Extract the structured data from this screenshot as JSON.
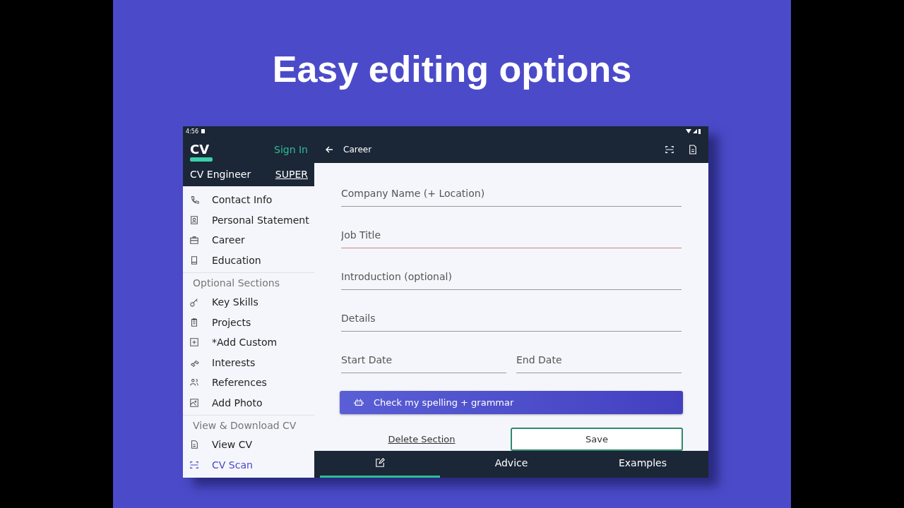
{
  "headline": "Easy editing options",
  "status_bar": {
    "time": "4:56"
  },
  "sidebar": {
    "logo": "CV",
    "sign_in": "Sign In",
    "app_name": "CV Engineer",
    "badge": "SUPER",
    "items": [
      {
        "kind": "item",
        "label": "Contact Info",
        "selected": false
      },
      {
        "kind": "item",
        "label": "Personal Statement",
        "selected": false
      },
      {
        "kind": "item",
        "label": "Career",
        "selected": false
      },
      {
        "kind": "item",
        "label": "Education",
        "selected": false
      },
      {
        "kind": "heading",
        "label": "Optional Sections"
      },
      {
        "kind": "item",
        "label": "Key Skills",
        "selected": false
      },
      {
        "kind": "item",
        "label": "Projects",
        "selected": false
      },
      {
        "kind": "item",
        "label": "*Add Custom",
        "selected": false
      },
      {
        "kind": "item",
        "label": "Interests",
        "selected": false
      },
      {
        "kind": "item",
        "label": "References",
        "selected": false
      },
      {
        "kind": "item",
        "label": "Add Photo",
        "selected": false
      },
      {
        "kind": "heading",
        "label": "View & Download CV"
      },
      {
        "kind": "item",
        "label": "View CV",
        "selected": false
      },
      {
        "kind": "item",
        "label": "CV Scan",
        "selected": true
      }
    ]
  },
  "header": {
    "title": "Career"
  },
  "form": {
    "rows": [
      [
        {
          "placeholder": "Company Name (+ Location)",
          "focused": false
        }
      ],
      [
        {
          "placeholder": "Job Title",
          "focused": true
        }
      ],
      [
        {
          "placeholder": "Introduction (optional)",
          "focused": false
        }
      ],
      [
        {
          "placeholder": "Details",
          "focused": false
        }
      ],
      [
        {
          "placeholder": "Start Date",
          "focused": false
        },
        {
          "placeholder": "End Date",
          "focused": false
        }
      ]
    ],
    "spell_button": "Check my spelling + grammar",
    "delete_link": "Delete Section",
    "save_button": "Save"
  },
  "tabs": [
    {
      "kind": "icon",
      "selected": true
    },
    {
      "kind": "text",
      "label": "Advice",
      "selected": false
    },
    {
      "kind": "text",
      "label": "Examples",
      "selected": false
    }
  ]
}
